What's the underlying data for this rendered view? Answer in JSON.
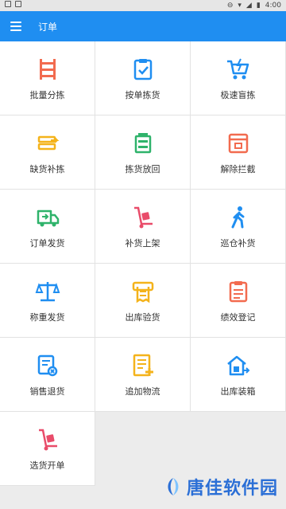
{
  "status_bar": {
    "time": "4:00"
  },
  "app_bar": {
    "title": "订单"
  },
  "tiles": [
    {
      "label": "批量分拣"
    },
    {
      "label": "按单拣货"
    },
    {
      "label": "极速盲拣"
    },
    {
      "label": "缺货补拣"
    },
    {
      "label": "拣货放回"
    },
    {
      "label": "解除拦截"
    },
    {
      "label": "订单发货"
    },
    {
      "label": "补货上架"
    },
    {
      "label": "巡仓补货"
    },
    {
      "label": "称重发货"
    },
    {
      "label": "出库验货"
    },
    {
      "label": "绩效登记"
    },
    {
      "label": "销售退货"
    },
    {
      "label": "追加物流"
    },
    {
      "label": "出库装箱"
    },
    {
      "label": "选货开单"
    }
  ],
  "watermark": {
    "text": "唐佳软件园"
  },
  "colors": {
    "primary": "#1f8ef1"
  }
}
